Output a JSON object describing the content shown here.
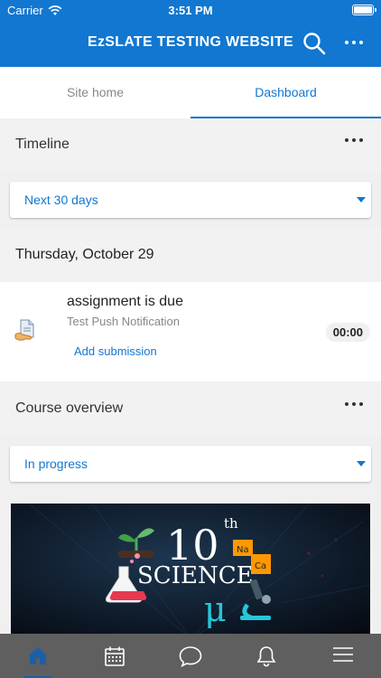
{
  "status_bar": {
    "carrier": "Carrier",
    "time": "3:51 PM"
  },
  "header": {
    "title": "EzSLATE TESTING WEBSITE"
  },
  "tabs": [
    {
      "label": "Site home",
      "active": false
    },
    {
      "label": "Dashboard",
      "active": true
    }
  ],
  "timeline": {
    "title": "Timeline",
    "filter": "Next 30 days",
    "date": "Thursday, October 29",
    "events": [
      {
        "title": "assignment is due",
        "course": "Test Push Notification",
        "action": "Add submission",
        "time": "00:00"
      }
    ]
  },
  "course_overview": {
    "title": "Course overview",
    "filter": "In progress",
    "course_image": {
      "number": "10",
      "suffix": "th",
      "subject": "SCIENCE"
    }
  },
  "bottom_nav": [
    {
      "icon": "home-icon",
      "active": true
    },
    {
      "icon": "calendar-icon",
      "active": false
    },
    {
      "icon": "messages-icon",
      "active": false
    },
    {
      "icon": "bell-icon",
      "active": false
    },
    {
      "icon": "menu-icon",
      "active": false
    }
  ],
  "colors": {
    "brand": "#1177d1",
    "bottom_bar": "#5f5f5f"
  }
}
